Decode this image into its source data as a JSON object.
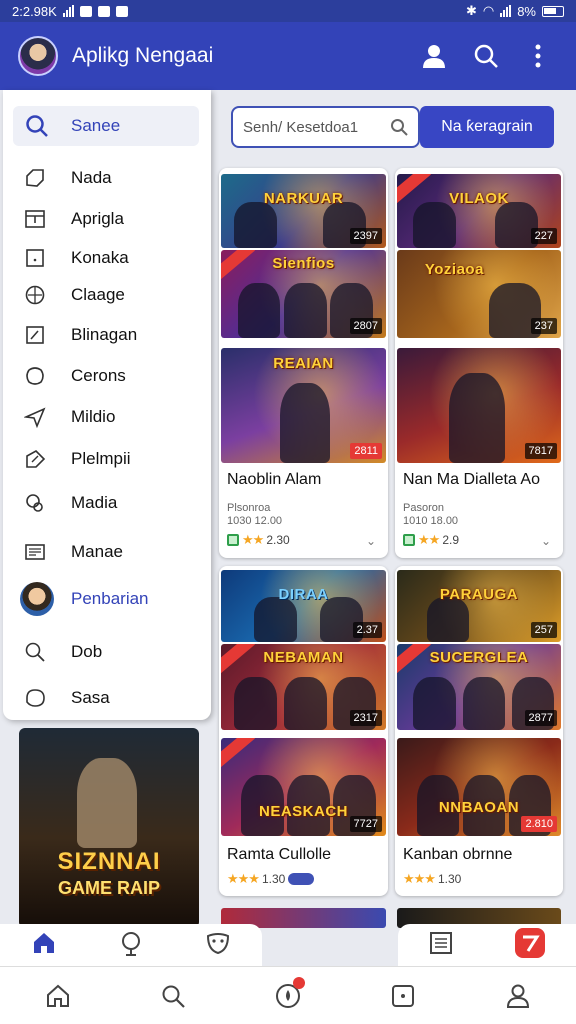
{
  "status": {
    "time": "2:2.98K",
    "battery": "8%"
  },
  "appbar": {
    "title": "Aplikg Nengaai"
  },
  "search": {
    "placeholder": "Senh/ Kesetdoa1",
    "button": "Na ƙeragrain"
  },
  "drawer": {
    "search_label": "Sanee",
    "items": [
      {
        "label": "Nada",
        "icon": "tag-icon"
      },
      {
        "label": "Aprigla",
        "icon": "calendar-icon"
      },
      {
        "label": "Konaka",
        "icon": "square-icon"
      },
      {
        "label": "Claage",
        "icon": "globe-icon"
      },
      {
        "label": "Blinagan",
        "icon": "chart-icon"
      },
      {
        "label": "Cerons",
        "icon": "circle-icon"
      },
      {
        "label": "Mildio",
        "icon": "send-icon"
      },
      {
        "label": "Plelmpii",
        "icon": "share-icon"
      },
      {
        "label": "Madia",
        "icon": "link-icon"
      },
      {
        "label": "Manae",
        "icon": "list-icon"
      },
      {
        "label": "Penbarian",
        "icon": "avatar"
      },
      {
        "label": "Dob",
        "icon": "search-icon"
      },
      {
        "label": "Sasa",
        "icon": "chat-icon"
      }
    ]
  },
  "cards": [
    {
      "thumbs": [
        {
          "title": "NARKUAR",
          "badge": "2397"
        },
        {
          "title": "Sienfios",
          "badge": "2807"
        },
        {
          "title": "REAIAN",
          "badge": "2811"
        }
      ],
      "name": "Naoblin Alam",
      "meta1": "Plsonroa",
      "meta2": "1030 12.00",
      "rating": "2.30"
    },
    {
      "thumbs": [
        {
          "title": "VILAOK",
          "badge": "227"
        },
        {
          "title": "Yoziaoa",
          "badge": "237"
        },
        {
          "title": "",
          "badge": "7817"
        }
      ],
      "name": "Nan Ma Dialleta Ao",
      "meta1": "Pasoron",
      "meta2": "1010 18.00",
      "rating": "2.9"
    },
    {
      "thumbs": [
        {
          "title": "DIRAA",
          "badge": "2.37"
        },
        {
          "title": "NEBAMAN",
          "badge": "2317"
        },
        {
          "title": "NEASKACH",
          "badge": "7727"
        }
      ],
      "name": "Ramta Cullolle",
      "meta1": "",
      "meta2": "",
      "rating": "1.30"
    },
    {
      "thumbs": [
        {
          "title": "PARAUGA",
          "badge": "257"
        },
        {
          "title": "SUCERGLEA",
          "badge": "2877"
        },
        {
          "title": "NNBAOAN",
          "badge": "2.810"
        }
      ],
      "name": "Kanban obrnne",
      "meta1": "",
      "meta2": "",
      "rating": "1.30"
    }
  ],
  "poster": {
    "title": "SIZNNAI",
    "subtitle": "GAME RAIP"
  },
  "colors": {
    "primary": "#3343b8",
    "star": "#f5a623",
    "accent": "#e53935"
  }
}
